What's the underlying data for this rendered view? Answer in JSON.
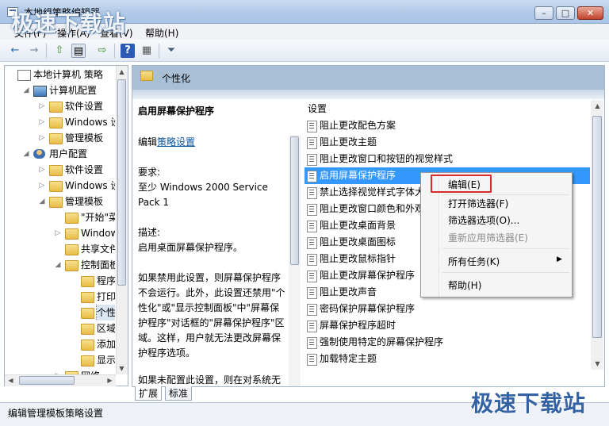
{
  "window": {
    "title": "本地组策略编辑器",
    "min_glyph": "–",
    "max_glyph": "□",
    "close_glyph": "✕"
  },
  "menu": [
    "文件(F)",
    "操作(A)",
    "查看(V)",
    "帮助(H)"
  ],
  "toolbar": {
    "icons": [
      "back-icon",
      "forward-icon",
      "up-folder-icon",
      "show-hide-tree-icon",
      "export-list-icon",
      "help-icon",
      "view-icon",
      "filter-icon"
    ],
    "glyphs": [
      "←",
      "→",
      "⇧",
      "▤",
      "⇨",
      "?",
      "▦",
      "⏷"
    ]
  },
  "tree": [
    {
      "label": "本地计算机 策略",
      "level": 0,
      "arrow": "",
      "icon": "policy-icon"
    },
    {
      "label": "计算机配置",
      "level": 1,
      "arrow": "◢",
      "icon": "computer-icon"
    },
    {
      "label": "软件设置",
      "level": 2,
      "arrow": "▷",
      "icon": "folder-icon"
    },
    {
      "label": "Windows 设置",
      "level": 2,
      "arrow": "▷",
      "icon": "folder-icon"
    },
    {
      "label": "管理模板",
      "level": 2,
      "arrow": "▷",
      "icon": "folder-icon"
    },
    {
      "label": "用户配置",
      "level": 1,
      "arrow": "◢",
      "icon": "user-icon"
    },
    {
      "label": "软件设置",
      "level": 2,
      "arrow": "▷",
      "icon": "folder-icon"
    },
    {
      "label": "Windows 设置",
      "level": 2,
      "arrow": "▷",
      "icon": "folder-icon"
    },
    {
      "label": "管理模板",
      "level": 2,
      "arrow": "◢",
      "icon": "folder-icon"
    },
    {
      "label": "\"开始\"菜单",
      "level": 3,
      "arrow": "",
      "icon": "folder-icon"
    },
    {
      "label": "Windows 组件",
      "level": 3,
      "arrow": "▷",
      "icon": "folder-icon"
    },
    {
      "label": "共享文件夹",
      "level": 3,
      "arrow": "",
      "icon": "folder-icon"
    },
    {
      "label": "控制面板",
      "level": 3,
      "arrow": "◢",
      "icon": "folder-icon"
    },
    {
      "label": "程序",
      "level": 4,
      "arrow": "",
      "icon": "folder-icon"
    },
    {
      "label": "打印机",
      "level": 4,
      "arrow": "",
      "icon": "folder-icon"
    },
    {
      "label": "个性化",
      "level": 4,
      "arrow": "",
      "icon": "folder-open-icon",
      "selected": true
    },
    {
      "label": "区域和语言",
      "level": 4,
      "arrow": "",
      "icon": "folder-icon"
    },
    {
      "label": "添加或删除程序",
      "level": 4,
      "arrow": "",
      "icon": "folder-icon"
    },
    {
      "label": "显示",
      "level": 4,
      "arrow": "",
      "icon": "folder-icon"
    },
    {
      "label": "网络",
      "level": 3,
      "arrow": "▷",
      "icon": "folder-icon"
    }
  ],
  "header": {
    "title": "个性化"
  },
  "description": {
    "title": "启用屏幕保护程序",
    "edit_prefix": "编辑",
    "edit_link": "策略设置",
    "req_label": "要求:",
    "req_value": "至少 Windows 2000 Service Pack 1",
    "desc_label": "描述:",
    "desc_value": "启用桌面屏幕保护程序。",
    "para1": "如果禁用此设置，则屏幕保护程序不会运行。此外，此设置还禁用\"个性化\"或\"显示控制面板\"中\"屏幕保护程序\"对话框的\"屏幕保护程序\"区域。这样，用户就无法更改屏幕保护程序选项。",
    "para2": "如果未配置此设置，则在对系统无"
  },
  "list": {
    "column_header": "设置",
    "items": [
      "阻止更改配色方案",
      "阻止更改主题",
      "阻止更改窗口和按钮的视觉样式",
      "启用屏幕保护程序",
      "禁止选择视觉样式字体大小",
      "阻止更改窗口颜色和外观",
      "阻止更改桌面背景",
      "阻止更改桌面图标",
      "阻止更改鼠标指针",
      "阻止更改屏幕保护程序",
      "阻止更改声音",
      "密码保护屏幕保护程序",
      "屏幕保护程序超时",
      "强制使用特定的屏幕保护程序",
      "加载特定主题"
    ],
    "selected_index": 3
  },
  "context_menu": {
    "edit": "编辑(E)",
    "open_filter": "打开筛选器(F)",
    "filter_options": "筛选器选项(O)...",
    "reapply_filter": "重新应用筛选器(E)",
    "all_tasks": "所有任务(K)",
    "submenu_arrow": "▶",
    "help": "帮助(H)"
  },
  "tabs": [
    "扩展",
    "标准"
  ],
  "status": "编辑管理模板策略设置",
  "watermark": "极速下载站",
  "colors": {
    "selection": "#3399ff",
    "header_band": "#a9bfd6",
    "highlight_box": "#d82b2b",
    "link": "#0b57a4"
  }
}
